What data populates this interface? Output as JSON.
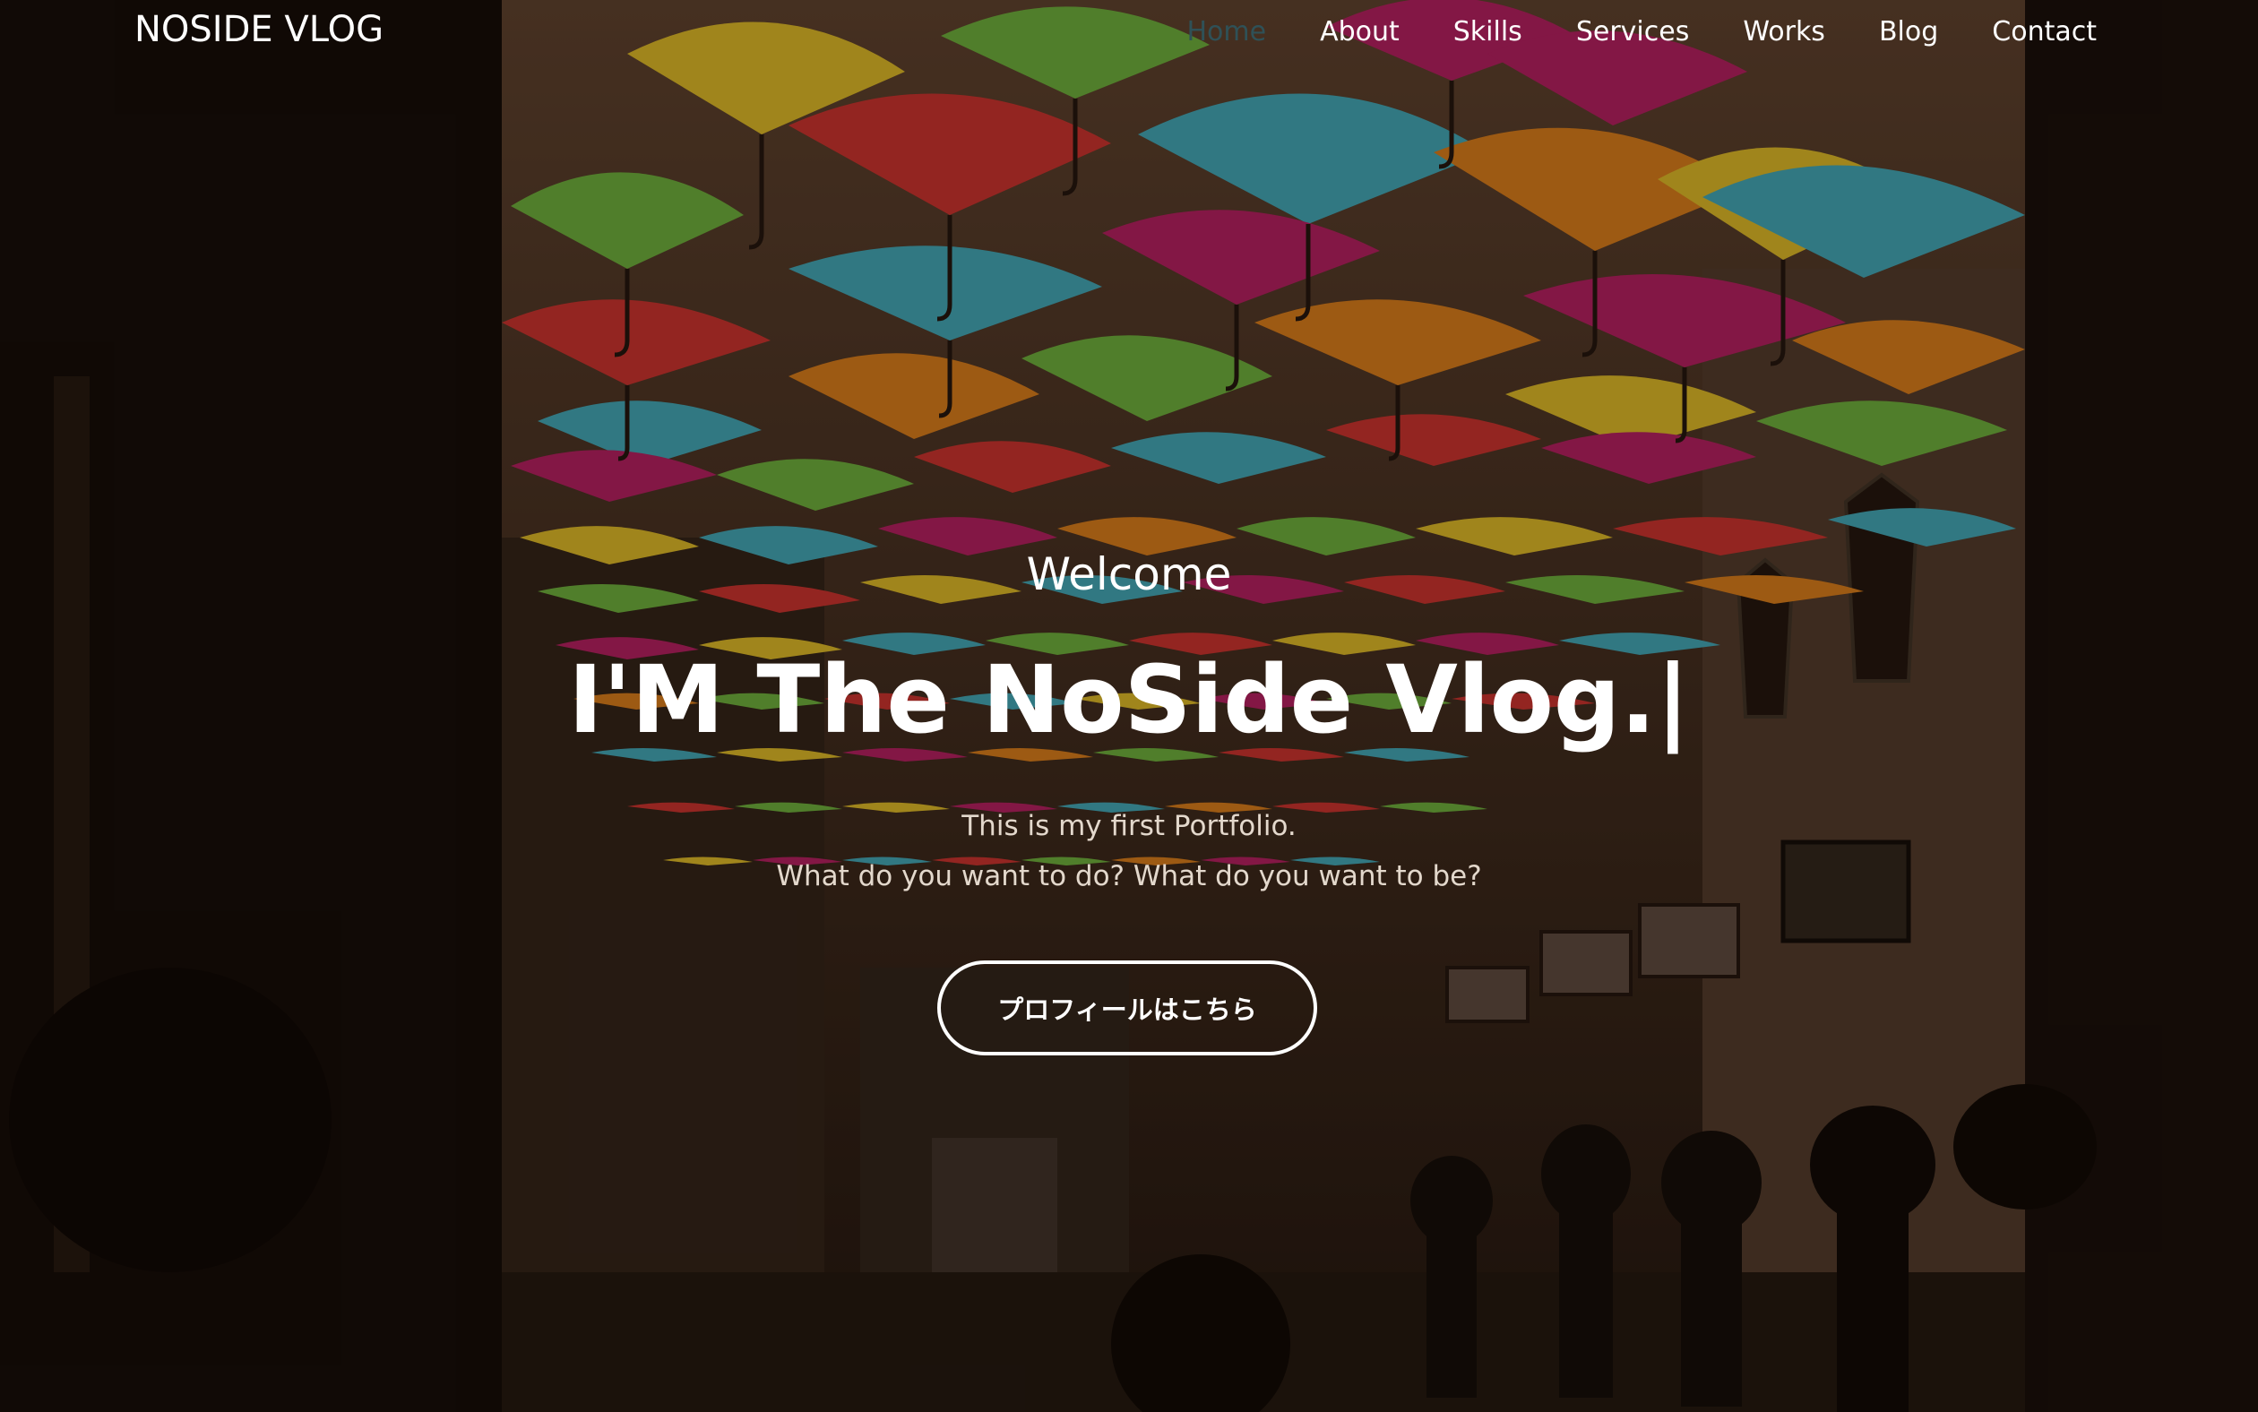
{
  "nav": {
    "brand": "NOSIDE VLOG",
    "items": [
      {
        "label": "Home",
        "active": true
      },
      {
        "label": "About",
        "active": false
      },
      {
        "label": "Skills",
        "active": false
      },
      {
        "label": "Services",
        "active": false
      },
      {
        "label": "Works",
        "active": false
      },
      {
        "label": "Blog",
        "active": false
      },
      {
        "label": "Contact",
        "active": false
      }
    ],
    "active_color": "#2f5157"
  },
  "hero": {
    "welcome": "Welcome",
    "headline": "I'M The NoSide Vlog.|",
    "subtitle_line1": "This is my first Portfolio.",
    "subtitle_line2": "What do you want to do? What do you want to be?",
    "cta_label": "プロフィールはこちら",
    "background_image": "colorful umbrellas hanging over an alley"
  },
  "colors": {
    "text": "#ffffff",
    "subtitle": "#e3d8cc",
    "umbrellas": [
      "#e23a33",
      "#f28a1e",
      "#f6cd2c",
      "#7cc242",
      "#4cb8c8",
      "#c9246a"
    ]
  }
}
